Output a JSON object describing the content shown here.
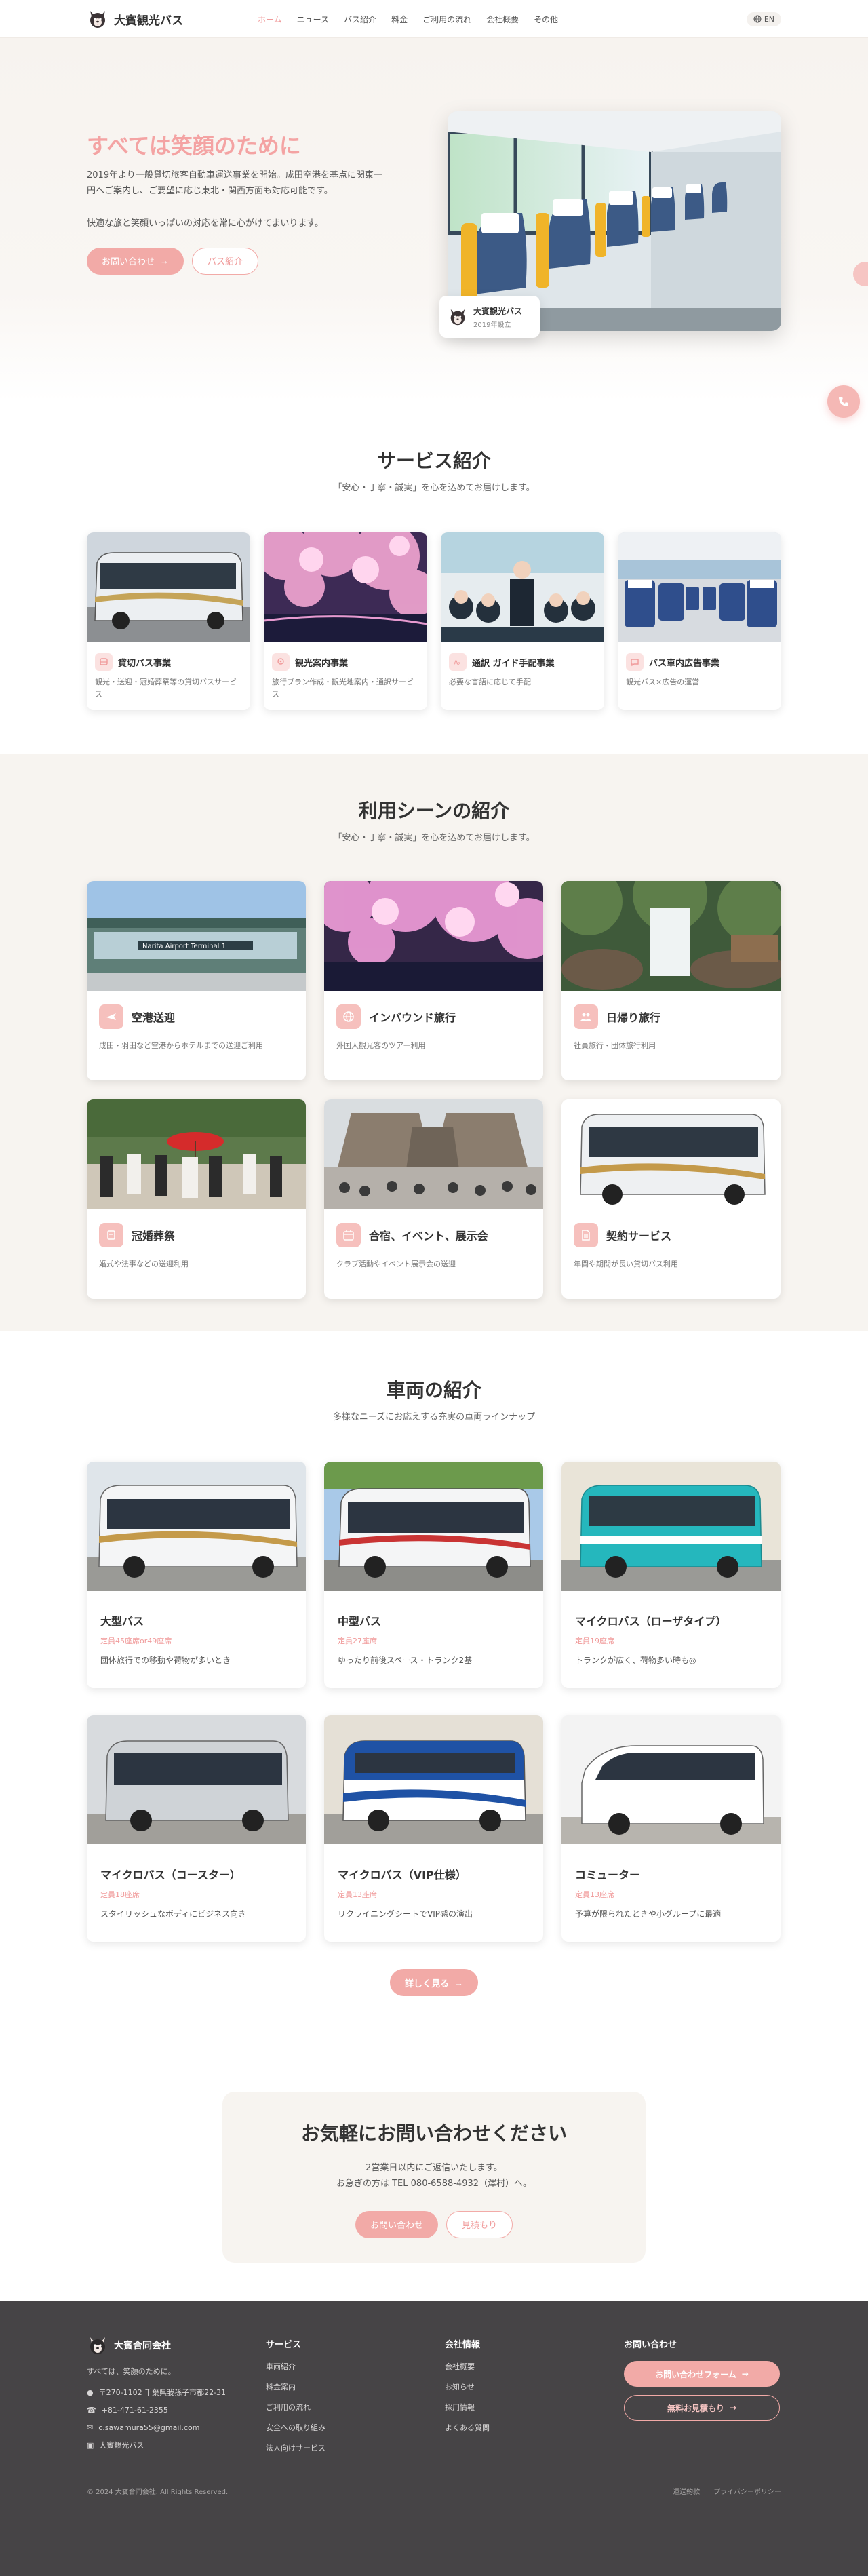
{
  "header": {
    "brand": "大賓観光バス",
    "nav": [
      "ホーム",
      "ニュース",
      "バス紹介",
      "料金",
      "ご利用の流れ",
      "会社概要",
      "その他"
    ],
    "lang": "EN"
  },
  "hero": {
    "title": "すべては笑顔のために",
    "desc": "2019年より一般貸切旅客自動車運送事業を開始。成田空港を基点に関東一円へご案内し、ご要望に応じ東北・関西方面も対応可能です。",
    "desc2": "快適な旅と笑顔いっぱいの対応を常に心がけてまいります。",
    "btn_contact": "お問い合わせ",
    "btn_bus": "バス紹介",
    "badge_title": "大賓観光バス",
    "badge_sub": "2019年設立"
  },
  "services": {
    "title": "サービス紹介",
    "subtitle": "「安心・丁寧・誠実」を心を込めてお届けします。",
    "items": [
      {
        "title": "貸切バス事業",
        "desc": "観光・送迎・冠婚葬祭等の貸切バスサービス",
        "icon": "bus-icon"
      },
      {
        "title": "観光案内事業",
        "desc": "旅行プラン作成・観光地案内・通訳サービス",
        "icon": "map-pin-icon"
      },
      {
        "title": "通訳 ガイド手配事業",
        "desc": "必要な言語に応じて手配",
        "icon": "translate-icon"
      },
      {
        "title": "バス車内広告事業",
        "desc": "観光バス×広告の運営",
        "icon": "chat-icon"
      }
    ]
  },
  "scenes": {
    "title": "利用シーンの紹介",
    "subtitle": "「安心・丁寧・誠実」を心を込めてお届けします。",
    "items": [
      {
        "title": "空港送迎",
        "desc": "成田・羽田など空港からホテルまでの送迎ご利用",
        "icon": "plane-icon"
      },
      {
        "title": "インバウンド旅行",
        "desc": "外国人観光客のツアー利用",
        "icon": "globe-icon"
      },
      {
        "title": "日帰り旅行",
        "desc": "社員旅行・団体旅行利用",
        "icon": "people-icon"
      },
      {
        "title": "冠婚葬祭",
        "desc": "婚式や法事などの送迎利用",
        "icon": "ceremony-icon"
      },
      {
        "title": "合宿、イベント、展示会",
        "desc": "クラブ活動やイベント展示会の送迎",
        "icon": "calendar-icon"
      },
      {
        "title": "契約サービス",
        "desc": "年間や期間が長い貸切バス利用",
        "icon": "document-icon"
      }
    ]
  },
  "vehicles": {
    "title": "車両の紹介",
    "subtitle": "多様なニーズにお応えする充実の車両ラインナップ",
    "items": [
      {
        "title": "大型バス",
        "cap": "定員45座席or49座席",
        "desc": "団体旅行での移動や荷物が多いとき"
      },
      {
        "title": "中型バス",
        "cap": "定員27座席",
        "desc": "ゆったり前後スペース・トランク2基"
      },
      {
        "title": "マイクロバス（ローザタイプ）",
        "cap": "定員19座席",
        "desc": "トランクが広く、荷物多い時も◎"
      },
      {
        "title": "マイクロバス（コースター）",
        "cap": "定員18座席",
        "desc": "スタイリッシュなボディにビジネス向き"
      },
      {
        "title": "マイクロバス（VIP仕様）",
        "cap": "定員13座席",
        "desc": "リクライニングシートでVIP感の演出"
      },
      {
        "title": "コミューター",
        "cap": "定員13座席",
        "desc": "予算が限られたときや小グループに最適"
      }
    ],
    "more": "詳しく見る"
  },
  "contact": {
    "title": "お気軽にお問い合わせください",
    "line1": "2営業日以内にご返信いたします。",
    "line2": "お急ぎの方は TEL 080-6588-4932（澤村）へ。",
    "btn_contact": "お問い合わせ",
    "btn_quote": "見積もり"
  },
  "footer": {
    "company": "大賓合同会社",
    "tagline": "すべては、笑顔のために。",
    "address": "〒270-1102 千葉県我孫子市都22-31",
    "phone": "+81-471-61-2355",
    "email": "c.sawamura55@gmail.com",
    "bus_name": "大賓観光バス",
    "col_service": {
      "title": "サービス",
      "links": [
        "車両紹介",
        "料金案内",
        "ご利用の流れ",
        "安全への取り組み",
        "法人向けサービス"
      ]
    },
    "col_company": {
      "title": "会社情報",
      "links": [
        "会社概要",
        "お知らせ",
        "採用情報",
        "よくある質問"
      ]
    },
    "col_contact": {
      "title": "お問い合わせ",
      "btn_form": "お問い合わせフォーム",
      "btn_quote": "無料お見積もり"
    },
    "copyright": "© 2024 大賓合同会社. All Rights Reserved.",
    "bottom_links": [
      "運送約款",
      "プライバシーポリシー"
    ]
  },
  "colors": {
    "accent": "#f2aaa7",
    "accent_text": "#f09a9a",
    "bg_warm": "#f7f4f0",
    "footer": "#464446"
  }
}
